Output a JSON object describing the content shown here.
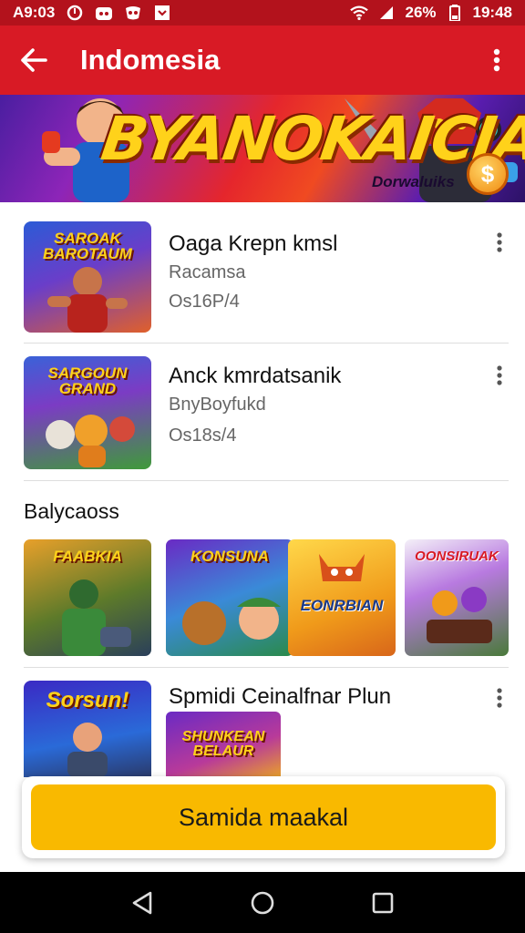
{
  "status_bar": {
    "time": "A9:03",
    "battery": "26%",
    "clock": "19:48"
  },
  "app_bar": {
    "title": "Indomesia"
  },
  "banner": {
    "title": "BYANOKAICIA",
    "caption": "Dorwaluiks",
    "coin_symbol": "$"
  },
  "list": [
    {
      "title": "Oaga Krepn kmsl",
      "subtitle": "Racamsa",
      "meta": "Os16P/4",
      "thumb_text": "SAROAK BAROTAUM"
    },
    {
      "title": "Anck kmrdatsanik",
      "subtitle": "BnyBoyfukd",
      "meta": "Os18s/4",
      "thumb_text": "SARGOUN GRAND"
    }
  ],
  "section": {
    "title": "Balycaoss",
    "items": [
      {
        "label": "FAABKIA"
      },
      {
        "label": "KONSUNA"
      },
      {
        "label": "EONRBIAN"
      },
      {
        "label": "OONSIRUAK"
      }
    ]
  },
  "featured": {
    "title": "Spmidi Ceinalfnar Plun",
    "thumb_text": "Sorsun!",
    "mini_text": "SHUNKEAN BELAUR"
  },
  "cta": {
    "label": "Samida maakal"
  },
  "colors": {
    "app_bar": "#d81a25",
    "status_bar": "#b3121c",
    "cta": "#f9b900"
  },
  "icons": [
    "back-arrow-icon",
    "more-vert-icon",
    "nav-back-icon",
    "nav-home-icon",
    "nav-recents-icon"
  ]
}
